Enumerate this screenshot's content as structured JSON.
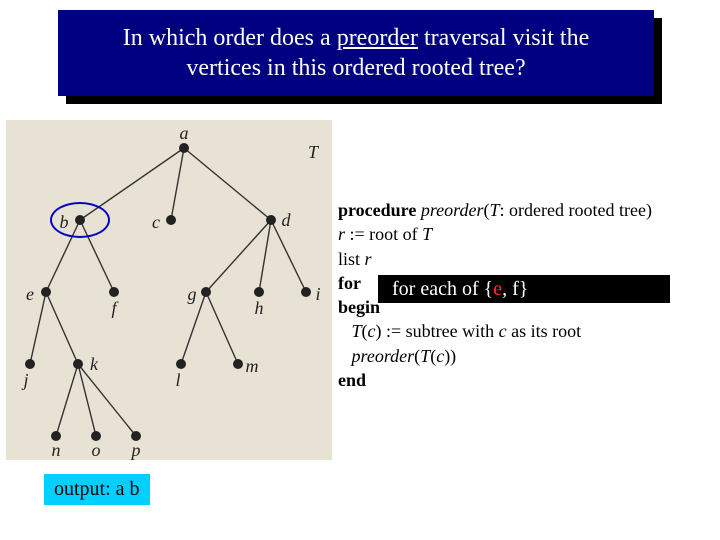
{
  "title": {
    "prefix": "In which order does a ",
    "underlined": "preorder",
    "suffix": " traversal visit the vertices in this ordered rooted tree?"
  },
  "tree": {
    "label_T": "T",
    "nodes": {
      "a": "a",
      "b": "b",
      "c": "c",
      "d": "d",
      "e": "e",
      "f": "f",
      "g": "g",
      "h": "h",
      "i": "i",
      "j": "j",
      "k": "k",
      "l": "l",
      "m": "m",
      "n": "n",
      "o": "o",
      "p": "p"
    },
    "highlight_node": "b"
  },
  "pseudocode": {
    "l1_kw": "procedure ",
    "l1_name": "preorder",
    "l1_rest1": "(",
    "l1_arg": "T",
    "l1_rest2": ": ordered rooted tree)",
    "l2_a": "r",
    "l2_b": " := root of ",
    "l2_c": "T",
    "l3_a": "list ",
    "l3_b": "r",
    "l4_kw": "for",
    "l5_kw": "begin",
    "l6_indent": "   ",
    "l6_a": "T",
    "l6_b": "(",
    "l6_c": "c",
    "l6_d": ") := subtree with ",
    "l6_e": "c",
    "l6_f": " as its root",
    "l7_indent": "   ",
    "l7_a": "preorder",
    "l7_b": "(",
    "l7_c": "T",
    "l7_d": "(",
    "l7_e": "c",
    "l7_f": "))",
    "l8_kw": "end"
  },
  "overlay": {
    "prefix": "for each of {",
    "red": "e",
    "suffix": ", f}"
  },
  "output": "output: a b"
}
